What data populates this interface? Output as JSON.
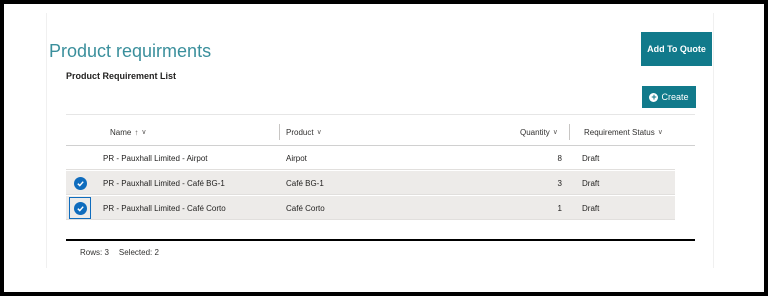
{
  "section": {
    "title": "Product requirments",
    "subtitle": "Product Requirement List"
  },
  "actions": {
    "add_to_quote_label": "Add To Quote",
    "create_label": "Create"
  },
  "grid": {
    "columns": {
      "name": "Name",
      "product": "Product",
      "quantity": "Quantity",
      "status": "Requirement Status"
    },
    "rows": [
      {
        "name": "PR - Pauxhall Limited - Airpot",
        "product": "Airpot",
        "quantity": "8",
        "status": "Draft",
        "selected": false
      },
      {
        "name": "PR - Pauxhall Limited - Café BG-1",
        "product": "Café BG-1",
        "quantity": "3",
        "status": "Draft",
        "selected": true
      },
      {
        "name": "PR - Pauxhall Limited - Café Corto",
        "product": "Café Corto",
        "quantity": "1",
        "status": "Draft",
        "selected": true
      }
    ]
  },
  "footer": {
    "rows_text": "Rows: 3",
    "selected_text": "Selected: 2"
  },
  "colors": {
    "accent": "#117a8b",
    "title": "#3a8f9c",
    "check": "#0f6cbd",
    "selected_row": "#edebe9"
  }
}
